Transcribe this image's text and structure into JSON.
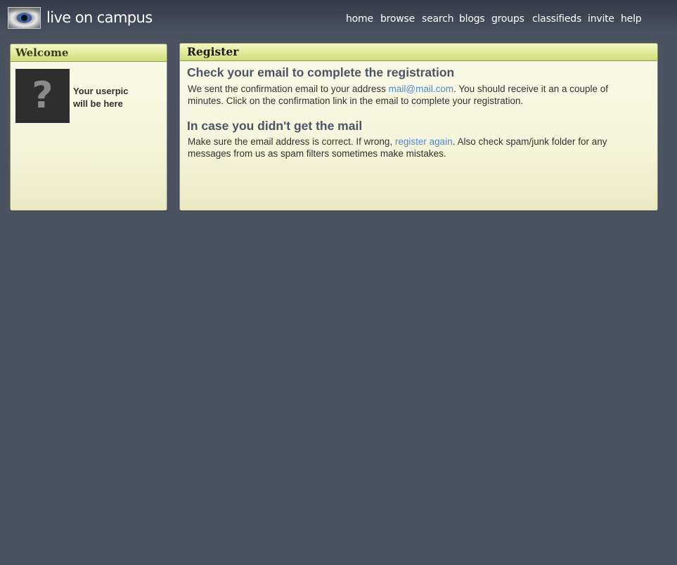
{
  "header": {
    "logo_text": "live on campus",
    "nav": [
      "home",
      "browse",
      "search",
      "blogs",
      "groups",
      "classifieds",
      "invite",
      "help"
    ]
  },
  "welcome": {
    "title": "Welcome",
    "userpic_glyph": "?",
    "userpic_caption_1": "Your userpic",
    "userpic_caption_2": "will be here"
  },
  "register": {
    "title": "Register",
    "heading1": "Check your email to complete the registration",
    "para1_before": "We sent the confirmation email to your address ",
    "para1_email": "mail@mail.com",
    "para1_after": ". You should receive it an a couple of minutes. Click on the confirmation link in the email to complete your registration.",
    "heading2": "In case you didn't get the mail",
    "para2_before": "Make sure the email address is correct. If wrong, ",
    "para2_link": "register again",
    "para2_after": ". Also check spam/junk folder for any messages from us as spam filters sometimes make mistakes."
  },
  "colors": {
    "background": "#4b5260",
    "link": "#4f8ad6",
    "heading": "#4d5466",
    "panel_header": "#dfe99a"
  },
  "icons": [
    "eye-logo-icon",
    "userpic-placeholder-icon"
  ]
}
